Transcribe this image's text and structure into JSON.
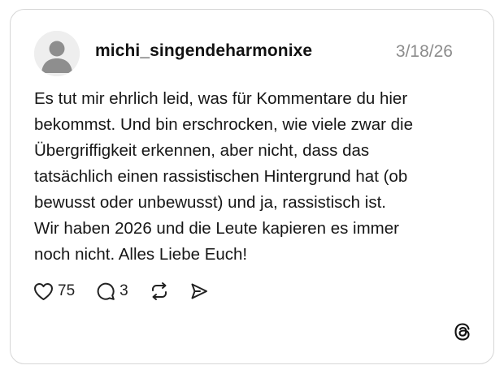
{
  "post": {
    "username": "michi_singendeharmonixe",
    "date": "3/18/26",
    "text": "Es tut mir ehrlich leid, was für Kommentare du hier\nbekommst. Und bin erschrocken, wie viele zwar die\nÜbergriffigkeit erkennen, aber nicht, dass das\ntatsächlich einen rassistischen Hintergrund hat (ob\nbewusst oder unbewusst) und ja, rassistisch ist.\nWir haben 2026 und die Leute kapieren es immer\nnoch nicht. Alles Liebe Euch!"
  },
  "actions": {
    "likes": "75",
    "replies": "3"
  },
  "icons": {
    "avatar": "default-avatar-icon",
    "like": "heart-icon",
    "reply": "comment-bubble-icon",
    "repost": "repost-icon",
    "share": "send-icon",
    "brand": "threads-logo-icon"
  },
  "colors": {
    "text": "#111111",
    "muted": "#8c8c8c",
    "border": "#d6d6d6",
    "avatar_bg": "#eeeeee",
    "avatar_fg": "#8e8e8e"
  }
}
